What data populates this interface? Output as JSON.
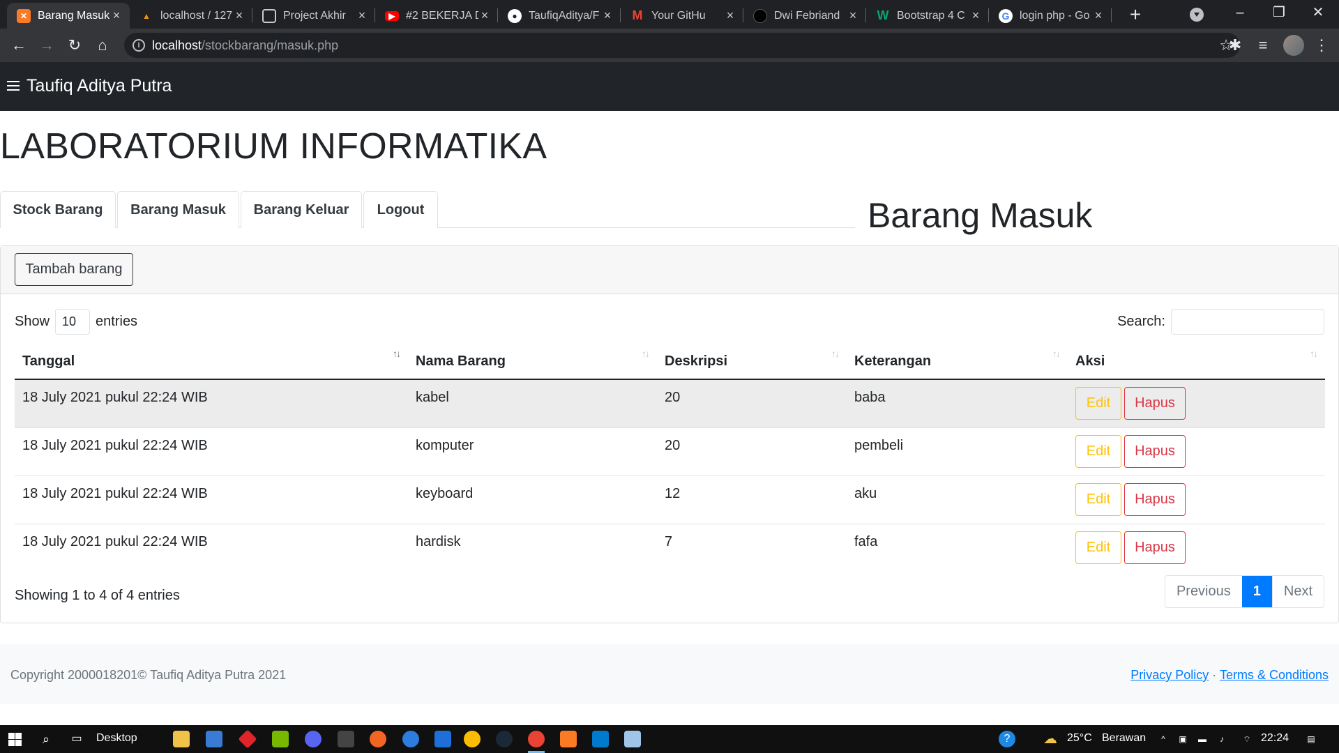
{
  "browser": {
    "tabs": [
      {
        "title": "Barang Masuk",
        "icon": "xampp-icon",
        "active": true
      },
      {
        "title": "localhost / 127",
        "icon": "phpmyadmin-icon"
      },
      {
        "title": "Project Akhir",
        "icon": "classroom-icon"
      },
      {
        "title": "#2 BEKERJA DI",
        "icon": "youtube-icon"
      },
      {
        "title": "TaufiqAditya/F",
        "icon": "github-icon"
      },
      {
        "title": "Your GitHu",
        "icon": "gmail-icon"
      },
      {
        "title": "Dwi Febriand",
        "icon": "github-icon"
      },
      {
        "title": "Bootstrap 4 C",
        "icon": "w3schools-icon"
      },
      {
        "title": "login php - Go",
        "icon": "google-icon"
      }
    ],
    "url_host": "localhost",
    "url_path": "/stockbarang/masuk.php"
  },
  "navbar": {
    "brand": "Taufiq Aditya Putra"
  },
  "page": {
    "title": "LABORATORIUM INFORMATIKA",
    "section_title": "Barang Masuk",
    "nav_tabs": [
      "Stock Barang",
      "Barang Masuk",
      "Barang Keluar",
      "Logout"
    ],
    "add_button": "Tambah barang"
  },
  "datatable": {
    "show_label": "Show",
    "entries_value": "10",
    "entries_label": "entries",
    "search_label": "Search:",
    "columns": [
      "Tanggal",
      "Nama Barang",
      "Deskripsi",
      "Keterangan",
      "Aksi"
    ],
    "rows": [
      {
        "tanggal": "18 July 2021 pukul 22:24 WIB",
        "nama": "kabel",
        "deskripsi": "20",
        "keterangan": "baba"
      },
      {
        "tanggal": "18 July 2021 pukul 22:24 WIB",
        "nama": "komputer",
        "deskripsi": "20",
        "keterangan": "pembeli"
      },
      {
        "tanggal": "18 July 2021 pukul 22:24 WIB",
        "nama": "keyboard",
        "deskripsi": "12",
        "keterangan": "aku"
      },
      {
        "tanggal": "18 July 2021 pukul 22:24 WIB",
        "nama": "hardisk",
        "deskripsi": "7",
        "keterangan": "fafa"
      }
    ],
    "edit_label": "Edit",
    "delete_label": "Hapus",
    "info": "Showing 1 to 4 of 4 entries",
    "pagination": {
      "previous": "Previous",
      "current": "1",
      "next": "Next"
    }
  },
  "footer": {
    "copyright": "Copyright 2000018201© Taufiq Aditya Putra 2021",
    "privacy": "Privacy Policy",
    "separator": "·",
    "terms": "Terms & Conditions"
  },
  "taskbar": {
    "desktop_label": "Desktop",
    "temperature": "25°C",
    "weather": "Berawan",
    "time": "22:24"
  },
  "colors": {
    "navbar_bg": "#212529",
    "primary": "#007bff",
    "warning": "#ffc107",
    "danger": "#dc3545"
  }
}
